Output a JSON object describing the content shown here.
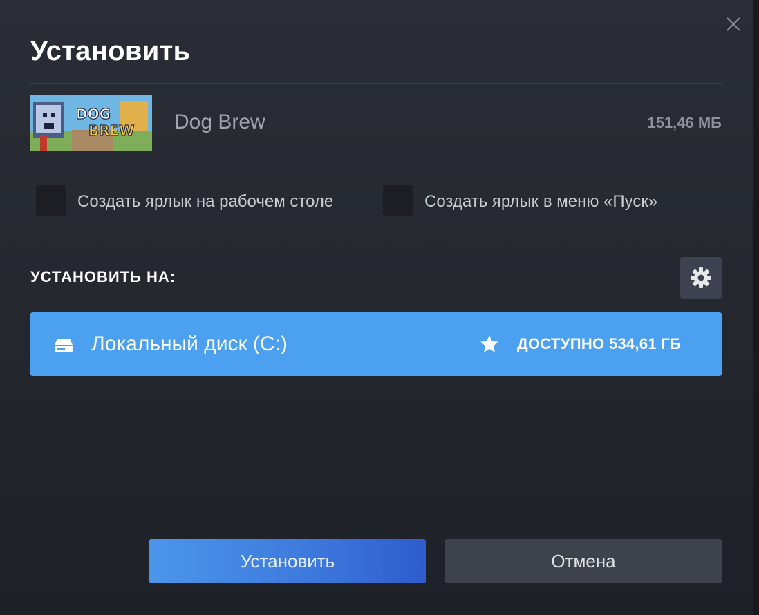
{
  "dialog": {
    "title": "Установить",
    "close_icon": "close-icon"
  },
  "game": {
    "name": "Dog Brew",
    "size": "151,46 МБ",
    "capsule_text_1": "DOG",
    "capsule_text_2": "BREW"
  },
  "options": {
    "desktop_shortcut_label": "Создать ярлык на рабочем столе",
    "desktop_shortcut_checked": false,
    "start_menu_shortcut_label": "Создать ярлык в меню «Пуск»",
    "start_menu_shortcut_checked": false
  },
  "install_location": {
    "label": "УСТАНОВИТЬ НА:",
    "settings_icon": "gear-icon",
    "drive": {
      "icon": "drive-icon",
      "name": "Локальный диск (C:)",
      "default_icon": "star-icon",
      "free_space": "ДОСТУПНО 534,61 ГБ"
    }
  },
  "buttons": {
    "install": "Установить",
    "cancel": "Отмена"
  },
  "colors": {
    "accent": "#4ba0ef",
    "background": "#24272e",
    "install_button_start": "#4c96ea",
    "install_button_end": "#2f5ccc",
    "cancel_button": "#3e424d"
  }
}
